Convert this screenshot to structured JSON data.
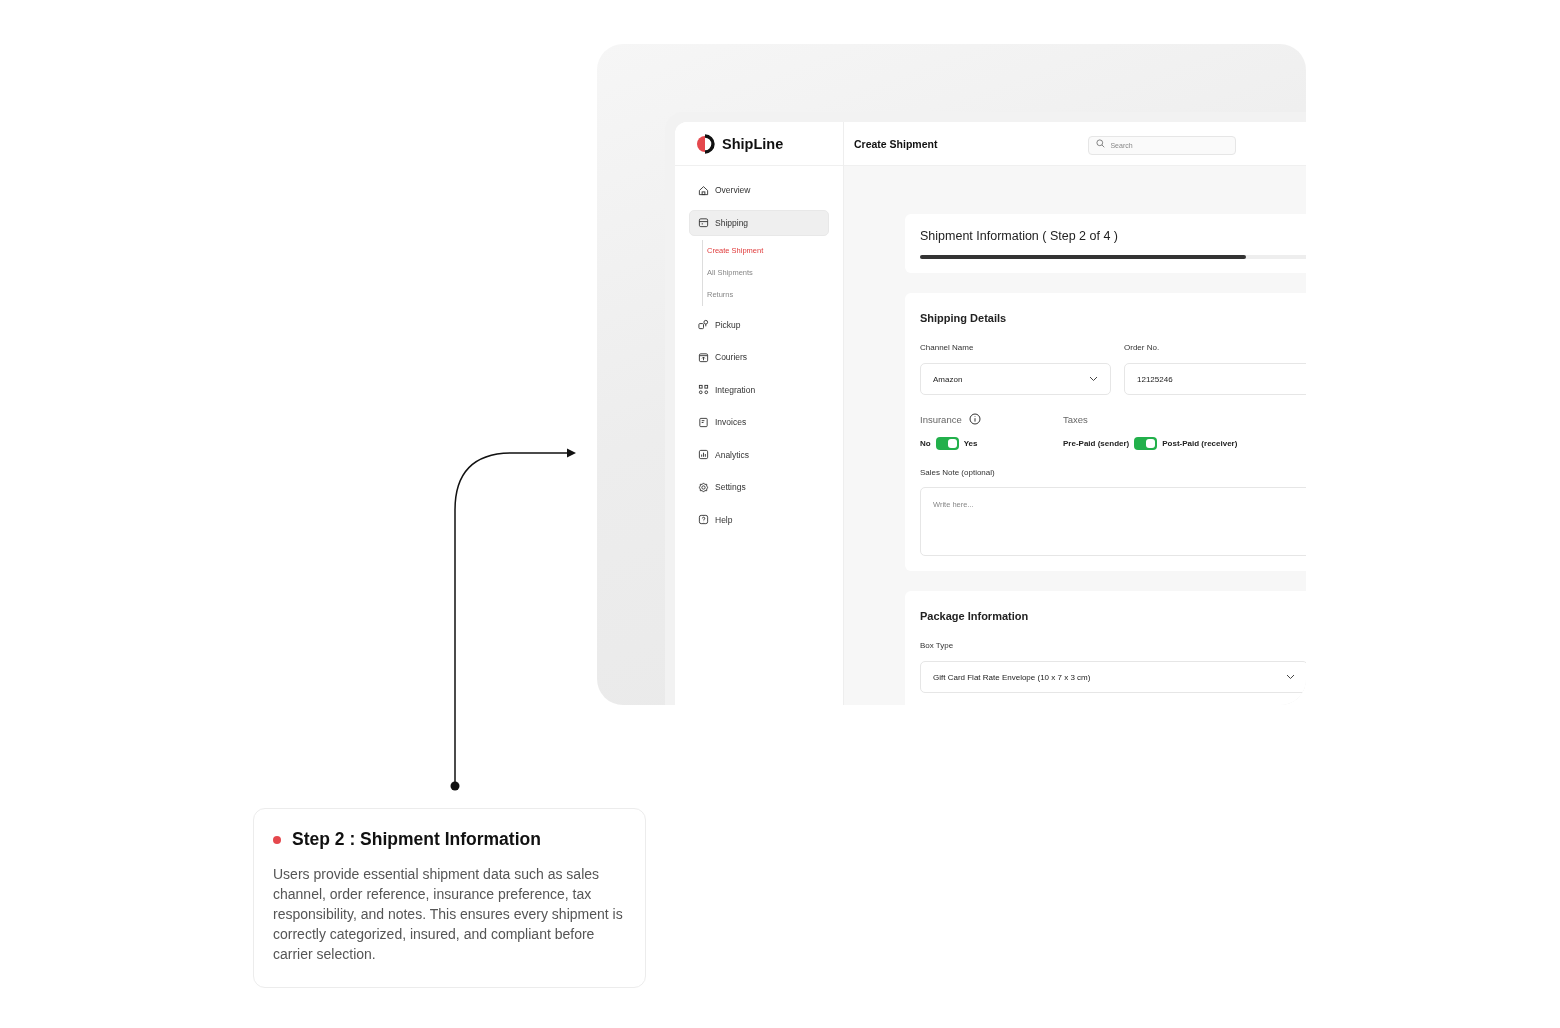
{
  "app": {
    "logo": "ShipLine",
    "page_title": "Create Shipment",
    "search": {
      "placeholder": "Search"
    }
  },
  "sidebar": {
    "items": [
      {
        "label": "Overview",
        "kind": "home",
        "selected": false
      },
      {
        "label": "Shipping",
        "kind": "box",
        "selected": true,
        "expanded": true,
        "children": [
          {
            "label": "Create Shipment",
            "selected": true
          },
          {
            "label": "All Shipments",
            "selected": false
          },
          {
            "label": "Returns",
            "selected": false
          }
        ]
      },
      {
        "label": "Pickup",
        "kind": "pickup",
        "selected": false
      },
      {
        "label": "Couriers",
        "kind": "courier",
        "selected": false
      },
      {
        "label": "Integration",
        "kind": "integration",
        "selected": false
      },
      {
        "label": "Invoices",
        "kind": "invoice",
        "selected": false
      },
      {
        "label": "Analytics",
        "kind": "analytics",
        "selected": false
      },
      {
        "label": "Settings",
        "kind": "settings",
        "selected": false
      },
      {
        "label": "Help",
        "kind": "help",
        "selected": false
      }
    ]
  },
  "progress": {
    "title": "Shipment Information ( Step 2 of 4 )",
    "level": 0.75
  },
  "shipping_details": {
    "title": "Shipping Details",
    "channel": {
      "label": "Channel Name",
      "value": "Amazon"
    },
    "order": {
      "label": "Order No.",
      "value": "12125246"
    },
    "insurance": {
      "label": "Insurance",
      "off_label": "No",
      "on_label": "Yes",
      "on": true
    },
    "taxes": {
      "label": "Taxes",
      "off_label": "Pre-Paid (sender)",
      "on_label": "Post-Paid (receiver)",
      "on": true
    },
    "sales_note": {
      "label": "Sales Note (optional)",
      "placeholder": "Write here..."
    }
  },
  "package": {
    "title": "Package Information",
    "box_type": {
      "label": "Box Type",
      "value": "Gift Card Flat Rate Envelope (10 x 7 x 3 cm)"
    }
  },
  "callout": {
    "title": "Step 2 : Shipment Information",
    "body": "Users provide essential shipment data such as sales channel, order reference, insurance preference, tax responsibility, and notes. This ensures every shipment is correctly categorized, insured, and compliant before carrier selection."
  }
}
